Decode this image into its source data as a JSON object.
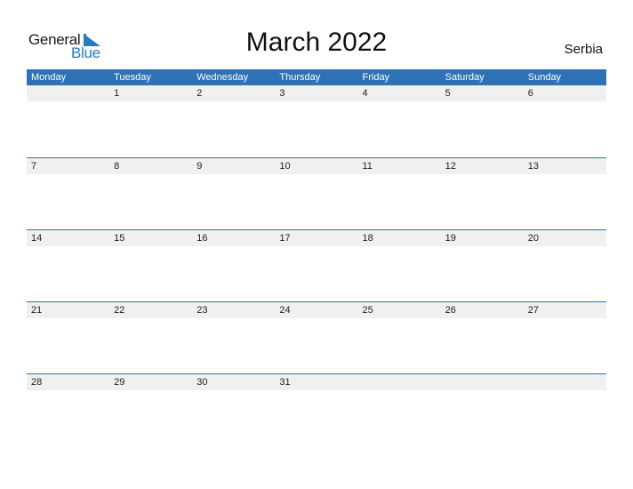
{
  "logo": {
    "general": "General",
    "blue": "Blue"
  },
  "title": "March 2022",
  "country": "Serbia",
  "weekdays": [
    "Monday",
    "Tuesday",
    "Wednesday",
    "Thursday",
    "Friday",
    "Saturday",
    "Sunday"
  ],
  "weeks": [
    [
      "",
      "1",
      "2",
      "3",
      "4",
      "5",
      "6"
    ],
    [
      "7",
      "8",
      "9",
      "10",
      "11",
      "12",
      "13"
    ],
    [
      "14",
      "15",
      "16",
      "17",
      "18",
      "19",
      "20"
    ],
    [
      "21",
      "22",
      "23",
      "24",
      "25",
      "26",
      "27"
    ],
    [
      "28",
      "29",
      "30",
      "31",
      "",
      "",
      ""
    ]
  ],
  "colors": {
    "accent": "#2e72b5",
    "day_row_bg": "#f0f0f0"
  }
}
